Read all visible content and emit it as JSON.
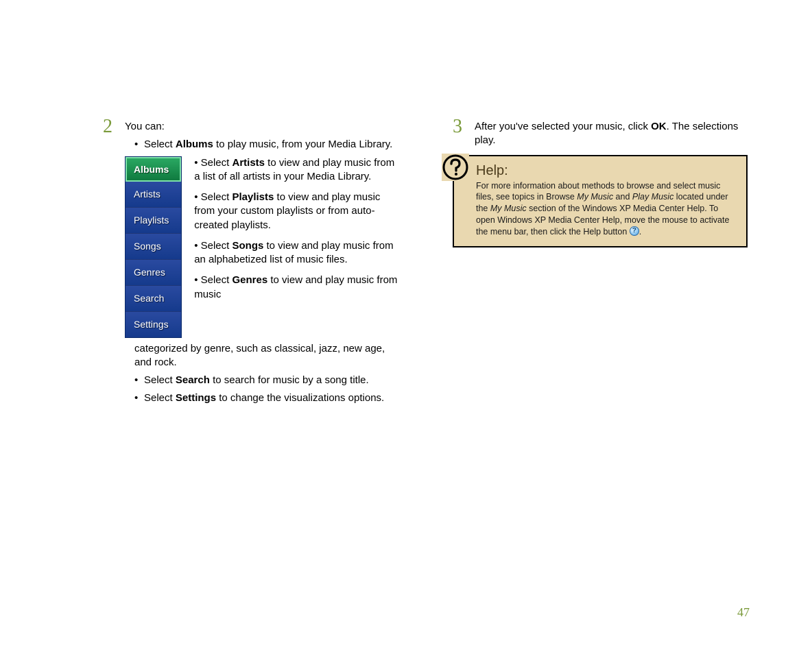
{
  "left": {
    "step_num": "2",
    "intro": "You can:",
    "bullet_albums_pre": "Select ",
    "bullet_albums_b": "Albums",
    "bullet_albums_post": " to play music, from your Media Library.",
    "menu": {
      "albums": "Albums",
      "artists": "Artists",
      "playlists": "Playlists",
      "songs": "Songs",
      "genres": "Genres",
      "search": "Search",
      "settings": "Settings"
    },
    "inline": {
      "artists_pre": "• Select ",
      "artists_b": "Artists",
      "artists_post": " to view and play music from a list of all artists in your Media Library.",
      "playlists_pre": "• Select ",
      "playlists_b": "Playlists",
      "playlists_post": " to view and play music from your custom playlists or from auto-created playlists.",
      "songs_pre": "• Select ",
      "songs_b": "Songs",
      "songs_post": " to view and play music from an alphabetized list of music files.",
      "genres_pre": "• Select ",
      "genres_b": "Genres",
      "genres_post_top": " to view and play music from music",
      "genres_cont": "categorized by genre, such as classical, jazz, new age, and rock."
    },
    "bullet_search_pre": "Select ",
    "bullet_search_b": "Search",
    "bullet_search_post": " to search for music by a song title.",
    "bullet_settings_pre": "Select ",
    "bullet_settings_b": "Settings",
    "bullet_settings_post": " to change the visualizations options."
  },
  "right": {
    "step_num": "3",
    "text_pre": "After you've selected your music, click ",
    "text_b": "OK",
    "text_post": ". The selections play.",
    "help": {
      "title": "Help:",
      "t1": "For more information about methods to browse and select music files, see topics in Browse ",
      "i1": "My Music",
      "t2": " and ",
      "i2": "Play Music",
      "t3": " located under the ",
      "i3": "My Music",
      "t4": " section of the Windows XP Media Center Help. To open Windows XP Media Center Help, move the mouse to activate the menu bar, then click the Help button ",
      "t5": "."
    }
  },
  "page_number": "47"
}
